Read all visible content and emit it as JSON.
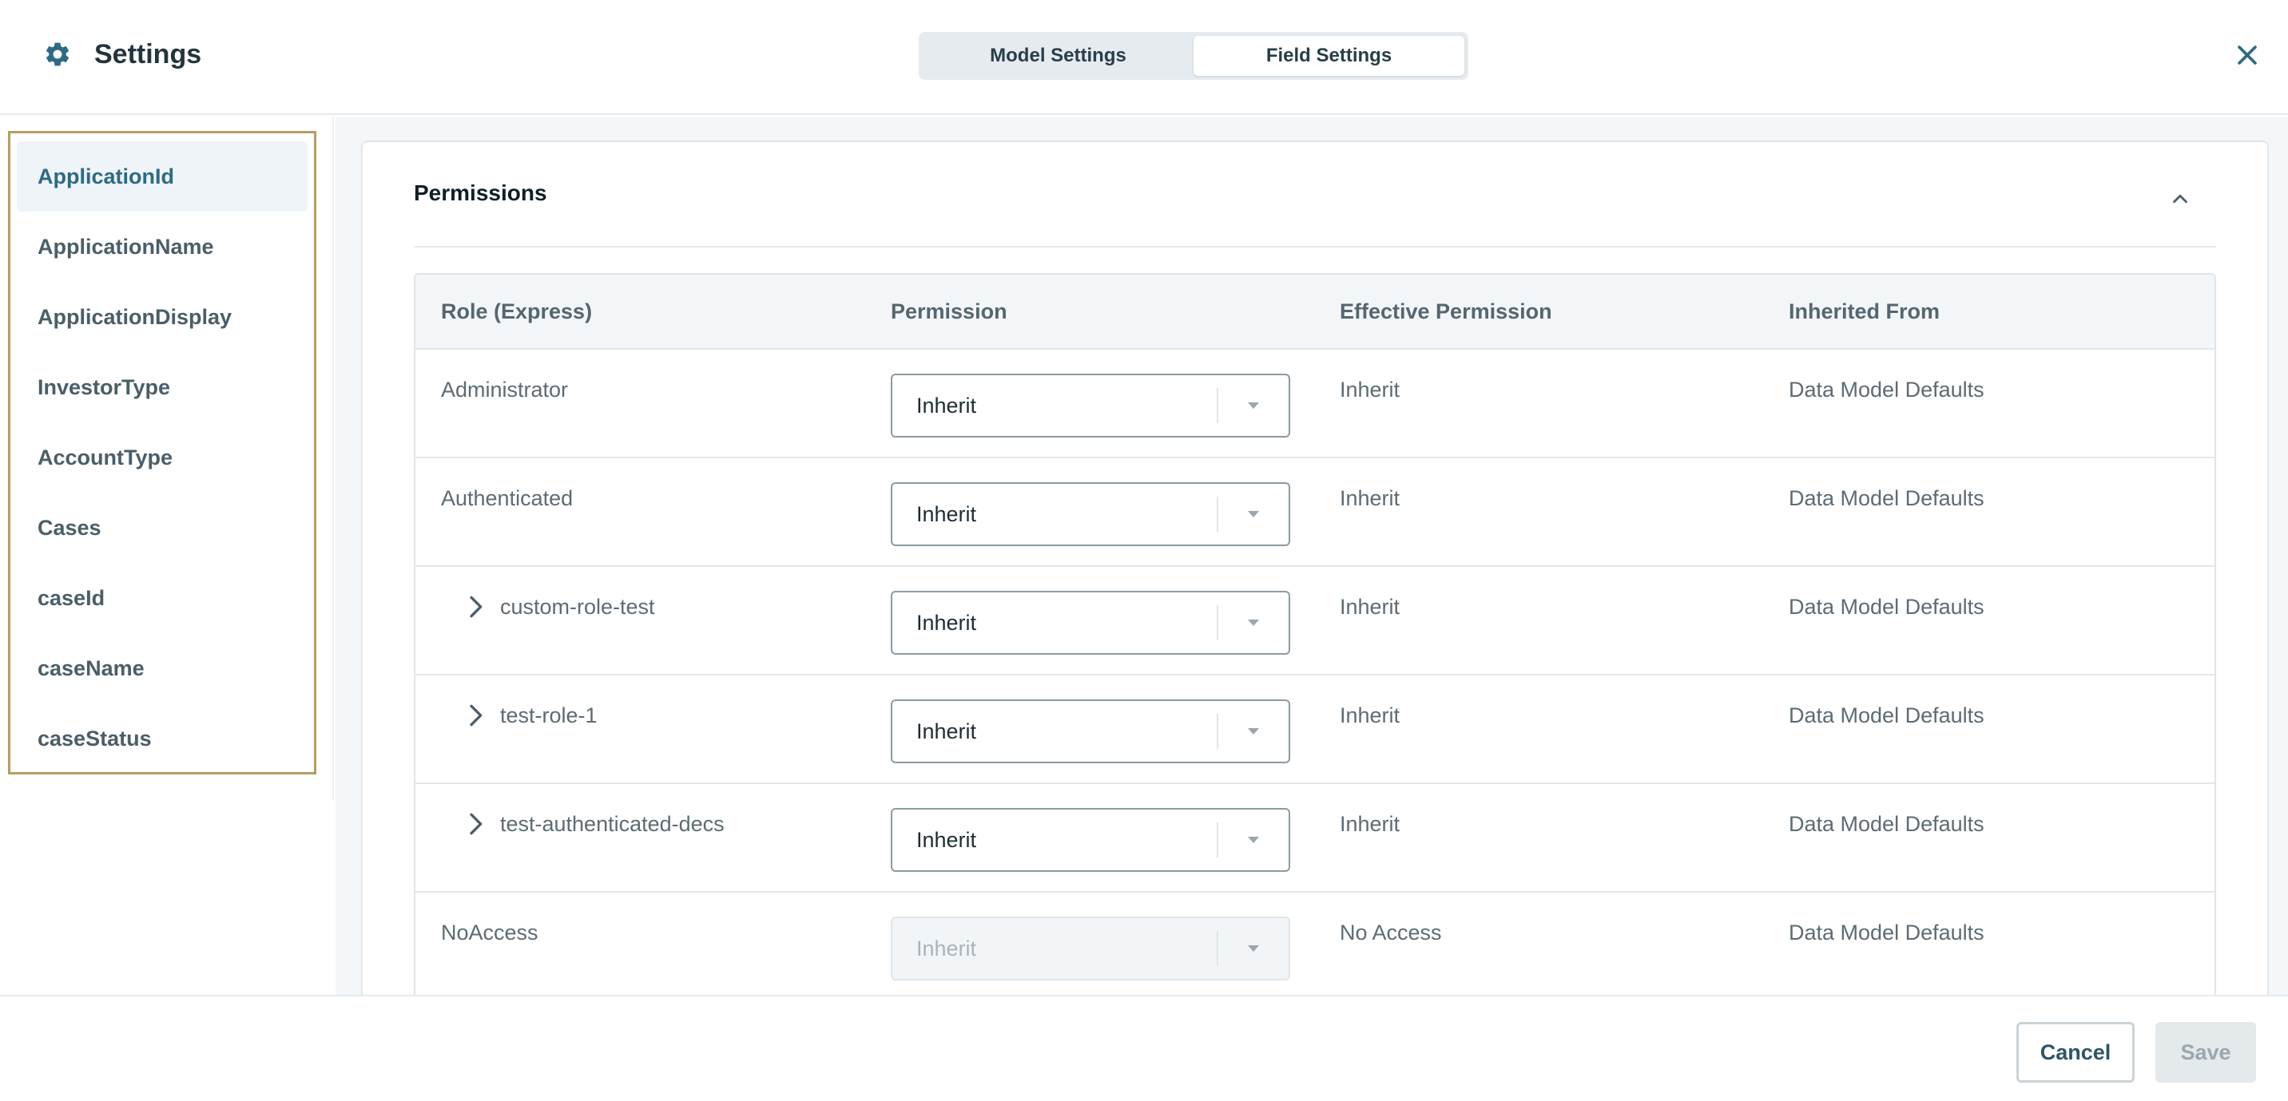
{
  "header": {
    "title": "Settings",
    "tabs": [
      {
        "label": "Model Settings",
        "active": false
      },
      {
        "label": "Field Settings",
        "active": true
      }
    ],
    "icons": {
      "settings": "gear-icon",
      "close": "close-icon"
    }
  },
  "sidebar": {
    "items": [
      {
        "label": "ApplicationId",
        "active": true
      },
      {
        "label": "ApplicationName",
        "active": false
      },
      {
        "label": "ApplicationDisplay",
        "active": false
      },
      {
        "label": "InvestorType",
        "active": false
      },
      {
        "label": "AccountType",
        "active": false
      },
      {
        "label": "Cases",
        "active": false
      },
      {
        "label": "caseId",
        "active": false
      },
      {
        "label": "caseName",
        "active": false
      },
      {
        "label": "caseStatus",
        "active": false
      }
    ]
  },
  "permissions": {
    "title": "Permissions",
    "columns": [
      "Role (Express)",
      "Permission",
      "Effective Permission",
      "Inherited From"
    ],
    "rows": [
      {
        "role": "Administrator",
        "expandable": false,
        "permission": "Inherit",
        "disabled": false,
        "effective": "Inherit",
        "inherited_from": "Data Model Defaults"
      },
      {
        "role": "Authenticated",
        "expandable": false,
        "permission": "Inherit",
        "disabled": false,
        "effective": "Inherit",
        "inherited_from": "Data Model Defaults"
      },
      {
        "role": "custom-role-test",
        "expandable": true,
        "permission": "Inherit",
        "disabled": false,
        "effective": "Inherit",
        "inherited_from": "Data Model Defaults"
      },
      {
        "role": "test-role-1",
        "expandable": true,
        "permission": "Inherit",
        "disabled": false,
        "effective": "Inherit",
        "inherited_from": "Data Model Defaults"
      },
      {
        "role": "test-authenticated-decs",
        "expandable": true,
        "permission": "Inherit",
        "disabled": false,
        "effective": "Inherit",
        "inherited_from": "Data Model Defaults"
      },
      {
        "role": "NoAccess",
        "expandable": false,
        "permission": "Inherit",
        "disabled": true,
        "effective": "No Access",
        "inherited_from": "Data Model Defaults"
      }
    ]
  },
  "footer": {
    "cancel_label": "Cancel",
    "save_label": "Save"
  },
  "colors": {
    "accent": "#2f6a84",
    "sidebar_outline": "#b59d62"
  }
}
